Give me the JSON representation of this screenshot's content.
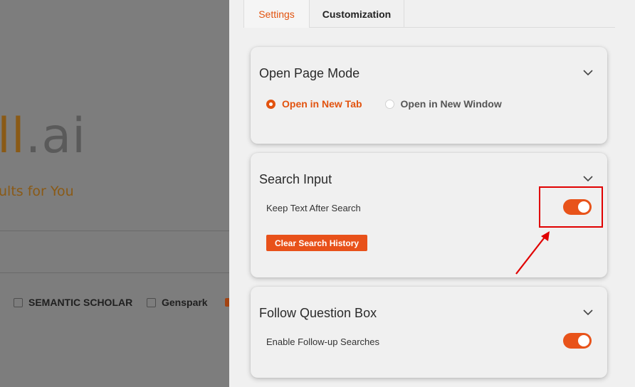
{
  "background": {
    "logo_main": "ll",
    "logo_suffix": ".ai",
    "tagline": "ults for You",
    "engines": [
      {
        "label": "SEMANTIC SCHOLAR"
      },
      {
        "label": "Genspark"
      }
    ]
  },
  "tabs": [
    {
      "label": "Settings",
      "active": true
    },
    {
      "label": "Customization",
      "active": false
    }
  ],
  "sections": {
    "open_page_mode": {
      "title": "Open Page Mode",
      "options": [
        {
          "label": "Open in New Tab",
          "selected": true
        },
        {
          "label": "Open in New Window",
          "selected": false
        }
      ]
    },
    "search_input": {
      "title": "Search Input",
      "keep_text_label": "Keep Text After Search",
      "keep_text_enabled": true,
      "clear_button_label": "Clear Search History"
    },
    "follow_question_box": {
      "title": "Follow Question Box",
      "followup_label": "Enable Follow-up Searches",
      "followup_enabled": true
    }
  },
  "colors": {
    "accent": "#e2530f",
    "annotation": "#e00000"
  }
}
